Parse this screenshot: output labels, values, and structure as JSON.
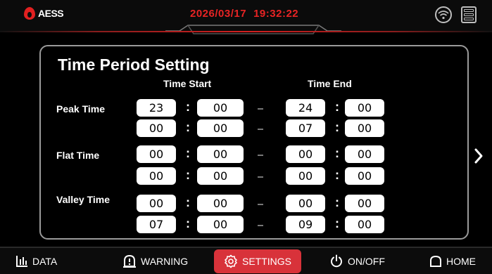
{
  "header": {
    "logo_text": "AESS",
    "date": "2026/03/17",
    "time": "19:32:22"
  },
  "page": {
    "title": "Time Period Setting",
    "col_start": "Time Start",
    "col_end": "Time End",
    "separator": ":"
  },
  "rows": [
    {
      "label": "Peak Time",
      "start_h": "23",
      "start_m": "00",
      "end_h": "24",
      "end_m": "00"
    },
    {
      "label": "",
      "start_h": "00",
      "start_m": "00",
      "end_h": "07",
      "end_m": "00"
    },
    {
      "label": "Flat Time",
      "start_h": "00",
      "start_m": "00",
      "end_h": "00",
      "end_m": "00"
    },
    {
      "label": "",
      "start_h": "00",
      "start_m": "00",
      "end_h": "00",
      "end_m": "00"
    },
    {
      "label": "Valley Time",
      "start_h": "00",
      "start_m": "00",
      "end_h": "00",
      "end_m": "00"
    },
    {
      "label": "",
      "start_h": "07",
      "start_m": "00",
      "end_h": "09",
      "end_m": "00"
    }
  ],
  "nav": {
    "data": "DATA",
    "warning": "WARNING",
    "settings": "SETTINGS",
    "onoff": "ON/OFF",
    "home": "HOME"
  },
  "colors": {
    "accent_red": "#d8323a",
    "datetime_red": "#e82424"
  },
  "icons": [
    "wifi-icon",
    "server-icon",
    "next-arrow-icon",
    "chart-icon",
    "warning-icon",
    "gear-icon",
    "power-icon",
    "home-icon"
  ]
}
